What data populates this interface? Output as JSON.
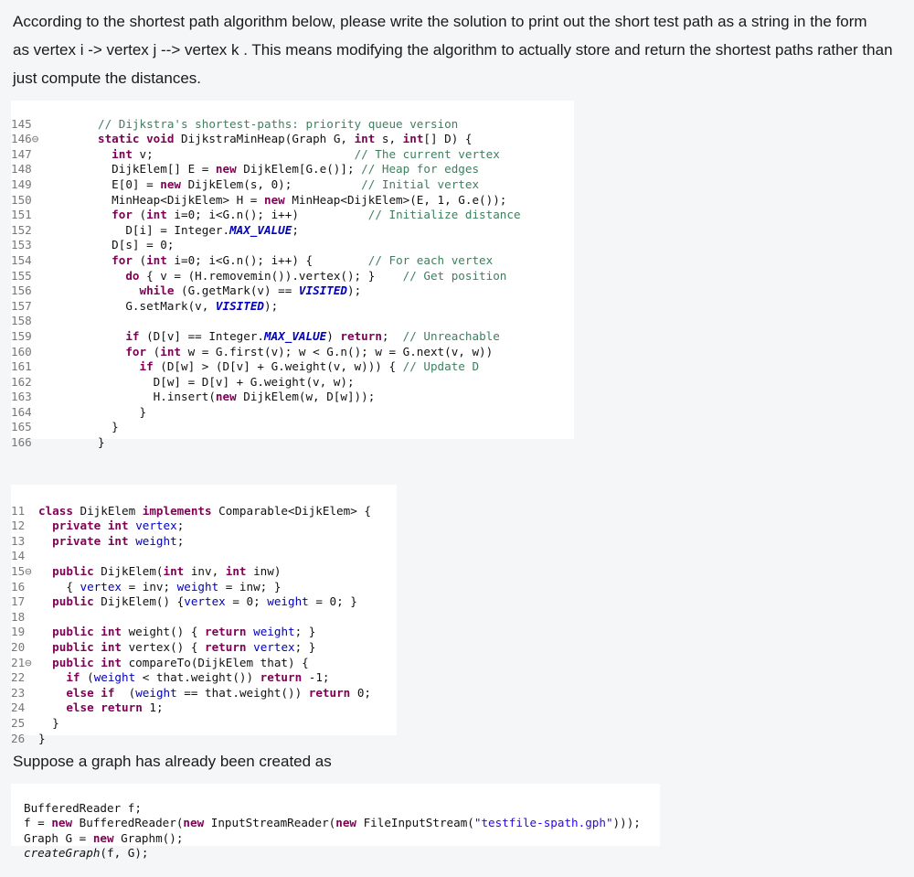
{
  "question": {
    "line1": "According to the shortest path algorithm below, please write the solution to print out the short test path as a string in the form",
    "line2": "as vertex i -> vertex j --> vertex k .  This means modifying the algorithm to actually store and return the shortest paths rather than",
    "line3": "just compute the distances."
  },
  "snippet1": {
    "line_numbers": [
      "145",
      "146⊖",
      "147",
      "148",
      "149",
      "150",
      "151",
      "152",
      "153",
      "154",
      "155",
      "156",
      "157",
      "158",
      "159",
      "160",
      "161",
      "162",
      "163",
      "164",
      "165",
      "166"
    ]
  },
  "snippet2": {
    "line_numbers": [
      "11",
      "12",
      "13",
      "14",
      "15⊖",
      "16",
      "17",
      "18",
      "19",
      "20",
      "21⊖",
      "22",
      "23",
      "24",
      "25",
      "26"
    ]
  },
  "supposition": "Suppose a graph has already been created as",
  "snippet3": {
    "file_name": "\"testfile-spath.gph\""
  }
}
